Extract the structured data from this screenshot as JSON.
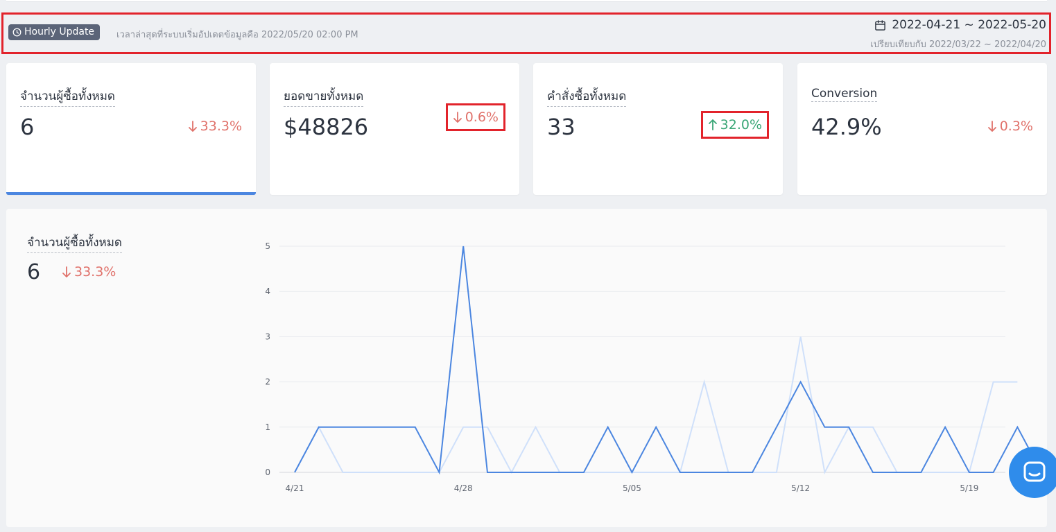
{
  "update_bar": {
    "badge_label": "Hourly Update",
    "update_text": "เวลาล่าสุดที่ระบบเริ่มอัปเดตข้อมูลคือ 2022/05/20 02:00 PM",
    "date_range": "2022-04-21 ~ 2022-05-20",
    "compare_text": "เปรียบเทียบกับ 2022/03/22 ~ 2022/04/20"
  },
  "metrics": [
    {
      "label": "จำนวนผู้ซื้อทั้งหมด",
      "value": "6",
      "change": "33.3%",
      "direction": "down",
      "active": true
    },
    {
      "label": "ยอดขายทั้งหมด",
      "value": "$48826",
      "change": "0.6%",
      "direction": "down"
    },
    {
      "label": "คำสั่งซื้อทั้งหมด",
      "value": "33",
      "change": "32.0%",
      "direction": "up"
    },
    {
      "label": "Conversion",
      "value": "42.9%",
      "change": "0.3%",
      "direction": "down"
    }
  ],
  "chart_panel": {
    "label": "จำนวนผู้ซื้อทั้งหมด",
    "value": "6",
    "change": "33.3%",
    "direction": "down"
  },
  "colors": {
    "current_series": "#4b86e0",
    "previous_series": "#cfe0fa",
    "down": "#e0716a",
    "up": "#3aa676",
    "highlight": "#e2232b"
  },
  "chart_data": {
    "type": "line",
    "x": [
      "4/21",
      "4/22",
      "4/23",
      "4/24",
      "4/25",
      "4/26",
      "4/27",
      "4/28",
      "4/29",
      "4/30",
      "5/01",
      "5/02",
      "5/03",
      "5/04",
      "5/05",
      "5/06",
      "5/07",
      "5/08",
      "5/09",
      "5/10",
      "5/11",
      "5/12",
      "5/13",
      "5/14",
      "5/15",
      "5/16",
      "5/17",
      "5/18",
      "5/19",
      "5/20"
    ],
    "x_tick_labels": [
      "4/21",
      "4/28",
      "5/05",
      "5/12",
      "5/19"
    ],
    "y_ticks": [
      0,
      1,
      2,
      3,
      4,
      5
    ],
    "ylim": [
      0,
      5
    ],
    "grid": true,
    "series": [
      {
        "values": [
          0,
          1,
          1,
          1,
          1,
          1,
          0,
          5,
          0,
          0,
          0,
          0,
          0,
          1,
          0,
          1,
          0,
          0,
          0,
          0,
          1,
          2,
          1,
          1,
          0,
          0,
          0,
          1,
          0,
          0,
          1,
          0
        ]
      },
      {
        "values": [
          0,
          1,
          0,
          0,
          0,
          0,
          0,
          1,
          1,
          0,
          1,
          0,
          0,
          0,
          0,
          0,
          0,
          2,
          0,
          0,
          0,
          3,
          0,
          1,
          1,
          0,
          0,
          0,
          0,
          2,
          2
        ]
      }
    ]
  },
  "icons": {
    "badge": "clock-icon",
    "date": "calendar-icon",
    "chat": "chat-icon"
  }
}
